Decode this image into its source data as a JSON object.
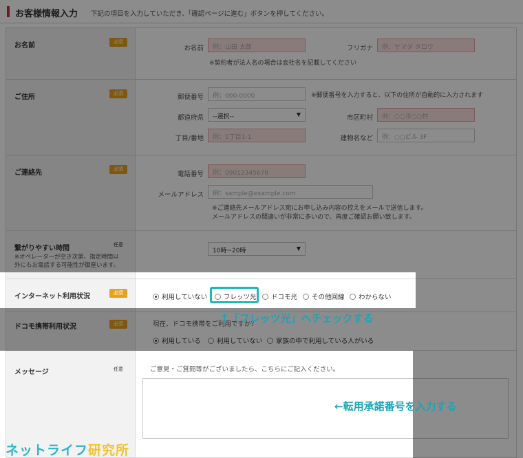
{
  "header": {
    "title": "お客様情報入力",
    "subtitle": "下記の項目を入力していただき、「確認ページに進む」ボタンを押してください。"
  },
  "badges": {
    "required": "必須",
    "optional": "任意"
  },
  "name_section": {
    "label": "お名前",
    "name_label": "お名前",
    "name_placeholder": "例：山田 太郎",
    "kana_label": "フリガナ",
    "kana_placeholder": "例：ヤマダ タロウ",
    "note": "※契約者が法人名の場合は会社名を記載してください"
  },
  "address_section": {
    "label": "ご住所",
    "postal_label": "郵便番号",
    "postal_placeholder": "例：000-0000",
    "postal_note": "※郵便番号を入力すると、以下の住所が自動的に入力されます",
    "pref_label": "都道府県",
    "pref_value": "--選択--",
    "city_label": "市区町村",
    "city_placeholder": "例：○○市○○村",
    "street_label": "丁目/番地",
    "street_placeholder": "例：1丁目1-1",
    "building_label": "建物名など",
    "building_placeholder": "例：○○ビル 3F"
  },
  "contact_section": {
    "label": "ご連絡先",
    "phone_label": "電話番号",
    "phone_placeholder": "例：09012345678",
    "email_label": "メールアドレス",
    "email_placeholder": "例：sample@example.com",
    "note_line1": "※ご連絡先メールアドレス宛にお申し込み内容の控えをメールで送信します。",
    "note_line2": "メールアドレスの間違いが非常に多いので、再度ご確認お願い致します。"
  },
  "time_section": {
    "label": "繋がりやすい時間",
    "note_line1": "※オペレーターが空き次第、指定時間以",
    "note_line2": "外にもお電話する可能性が御座います。",
    "select_value": "10時~20時"
  },
  "internet_section": {
    "label": "インターネット利用状況",
    "options": [
      "利用していない",
      "フレッツ光",
      "ドコモ光",
      "その他回線",
      "わからない"
    ]
  },
  "docomo_section": {
    "label": "ドコモ携帯利用状況",
    "intro": "現在、ドコモ携帯をご利用ですか？",
    "options": [
      "利用している",
      "利用していない",
      "家族の中で利用している人がいる"
    ]
  },
  "message_section": {
    "label": "メッセージ",
    "intro": "ご意見・ご質問等がございましたら、こちらにご記入ください。"
  },
  "annotations": {
    "flets": "↑「フレッツ光」へチェックする",
    "approval": "←転用承諾番号を入力する"
  },
  "brand": {
    "part1": "ネットライフ",
    "part2": "研究所"
  }
}
